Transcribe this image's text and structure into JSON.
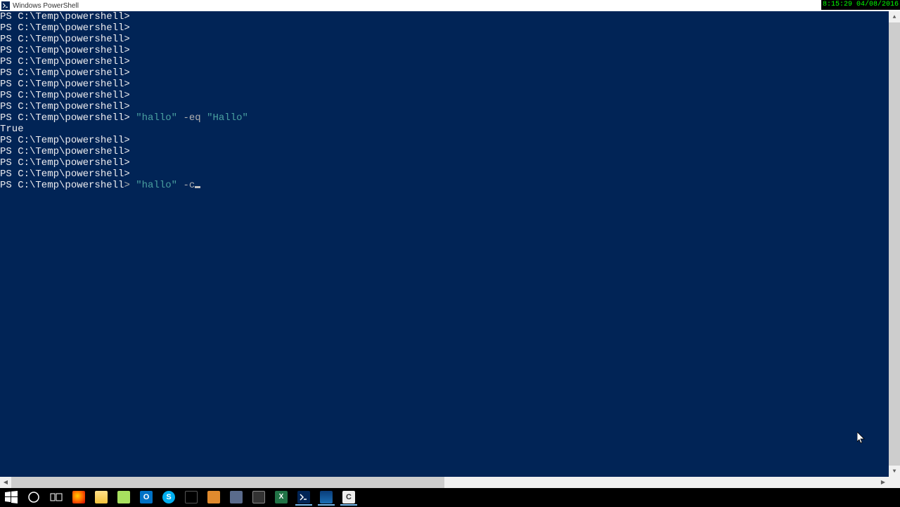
{
  "window": {
    "title": "Windows PowerShell"
  },
  "clock": {
    "time": "8:15:29",
    "date": "04/08/2016"
  },
  "terminal": {
    "prompt": "PS C:\\Temp\\powershell>",
    "lines": [
      {
        "type": "prompt_only"
      },
      {
        "type": "prompt_only"
      },
      {
        "type": "prompt_only"
      },
      {
        "type": "prompt_only"
      },
      {
        "type": "prompt_only"
      },
      {
        "type": "prompt_only"
      },
      {
        "type": "prompt_only"
      },
      {
        "type": "prompt_only"
      },
      {
        "type": "prompt_only"
      },
      {
        "type": "cmd1"
      },
      {
        "type": "output",
        "text": "True"
      },
      {
        "type": "prompt_only"
      },
      {
        "type": "prompt_only"
      },
      {
        "type": "prompt_only"
      },
      {
        "type": "prompt_only"
      },
      {
        "type": "cmd2"
      }
    ],
    "cmd1": {
      "str1": "\"hallo\"",
      "op": "-eq",
      "str2": "\"Hallo\""
    },
    "cmd2": {
      "str1": "\"hallo\"",
      "op": "-c"
    },
    "sep": " "
  },
  "taskbar": {
    "items": [
      {
        "name": "start-button",
        "icon": "windows"
      },
      {
        "name": "cortana-button",
        "icon": "circle"
      },
      {
        "name": "taskview-button",
        "icon": "taskview"
      },
      {
        "name": "firefox",
        "icon": "firefox"
      },
      {
        "name": "file-explorer",
        "icon": "folder"
      },
      {
        "name": "notepadpp",
        "icon": "npp"
      },
      {
        "name": "outlook",
        "icon": "outlook"
      },
      {
        "name": "skype",
        "icon": "skype"
      },
      {
        "name": "cmd",
        "icon": "cmd"
      },
      {
        "name": "app-orange",
        "icon": "orange"
      },
      {
        "name": "app-util",
        "icon": "util"
      },
      {
        "name": "app-box",
        "icon": "box"
      },
      {
        "name": "excel",
        "icon": "excel"
      },
      {
        "name": "powershell",
        "icon": "ps",
        "active": true
      },
      {
        "name": "powershell-ise",
        "icon": "psise",
        "active": true
      },
      {
        "name": "app-c",
        "icon": "appc",
        "active": true
      }
    ]
  }
}
